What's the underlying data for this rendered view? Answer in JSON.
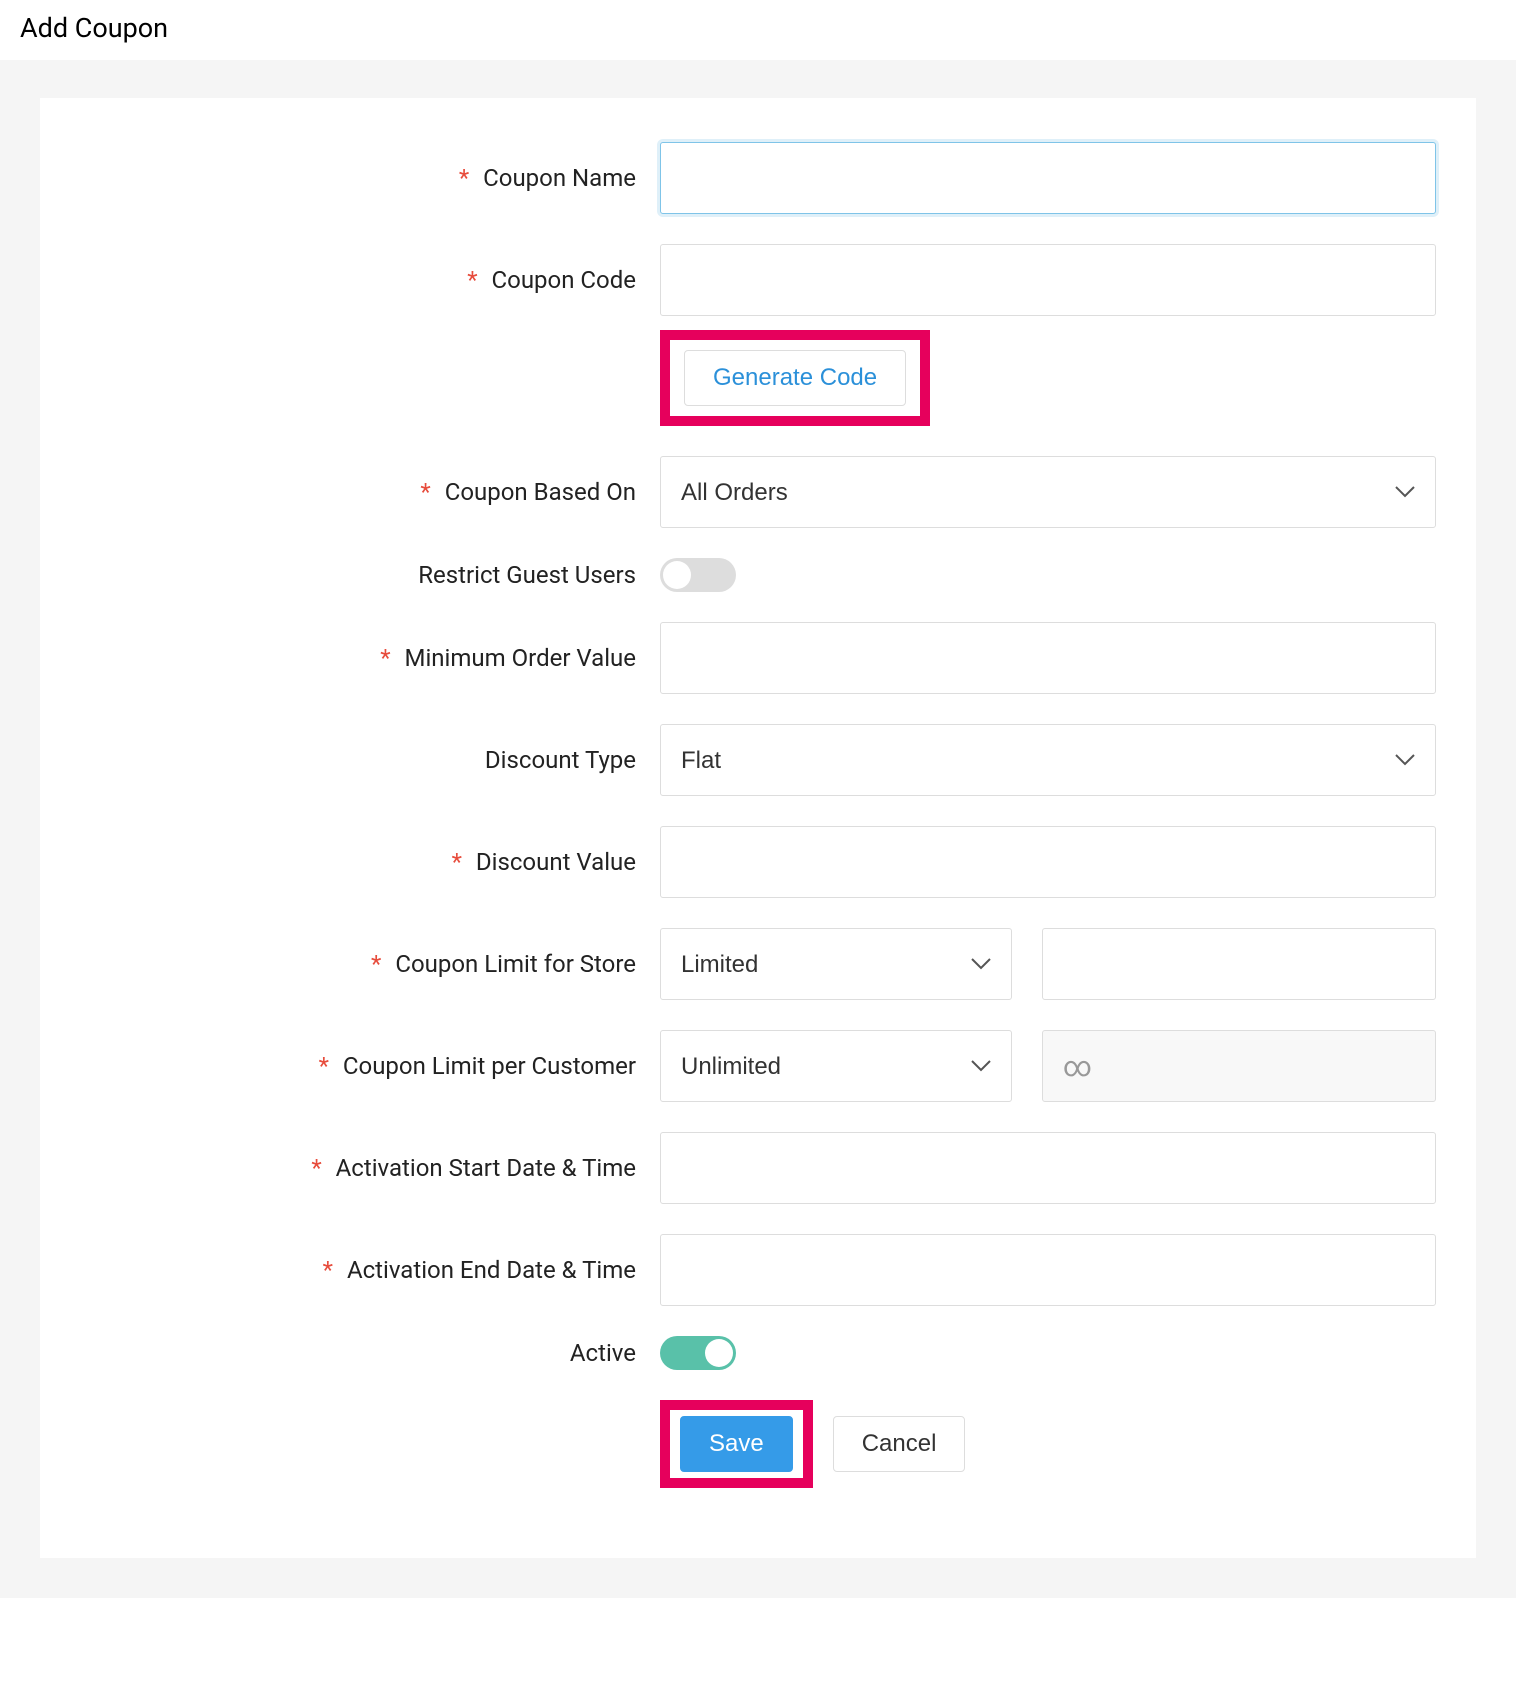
{
  "page": {
    "title": "Add Coupon"
  },
  "labels": {
    "coupon_name": "Coupon Name",
    "coupon_code": "Coupon Code",
    "generate_code": "Generate Code",
    "coupon_based_on": "Coupon Based On",
    "restrict_guest_users": "Restrict Guest Users",
    "minimum_order_value": "Minimum Order Value",
    "discount_type": "Discount Type",
    "discount_value": "Discount Value",
    "coupon_limit_store": "Coupon Limit for Store",
    "coupon_limit_customer": "Coupon Limit per Customer",
    "activation_start": "Activation Start Date & Time",
    "activation_end": "Activation End Date & Time",
    "active": "Active",
    "save": "Save",
    "cancel": "Cancel"
  },
  "values": {
    "coupon_name": "",
    "coupon_code": "",
    "coupon_based_on": "All Orders",
    "restrict_guest_users": false,
    "minimum_order_value": "",
    "discount_type": "Flat",
    "discount_value": "",
    "coupon_limit_store_mode": "Limited",
    "coupon_limit_store_value": "",
    "coupon_limit_customer_mode": "Unlimited",
    "coupon_limit_customer_value": "∞",
    "activation_start": "",
    "activation_end": "",
    "active": true
  },
  "required": {
    "coupon_name": true,
    "coupon_code": true,
    "coupon_based_on": true,
    "restrict_guest_users": false,
    "minimum_order_value": true,
    "discount_type": false,
    "discount_value": true,
    "coupon_limit_store": true,
    "coupon_limit_customer": true,
    "activation_start": true,
    "activation_end": true,
    "active": false
  }
}
